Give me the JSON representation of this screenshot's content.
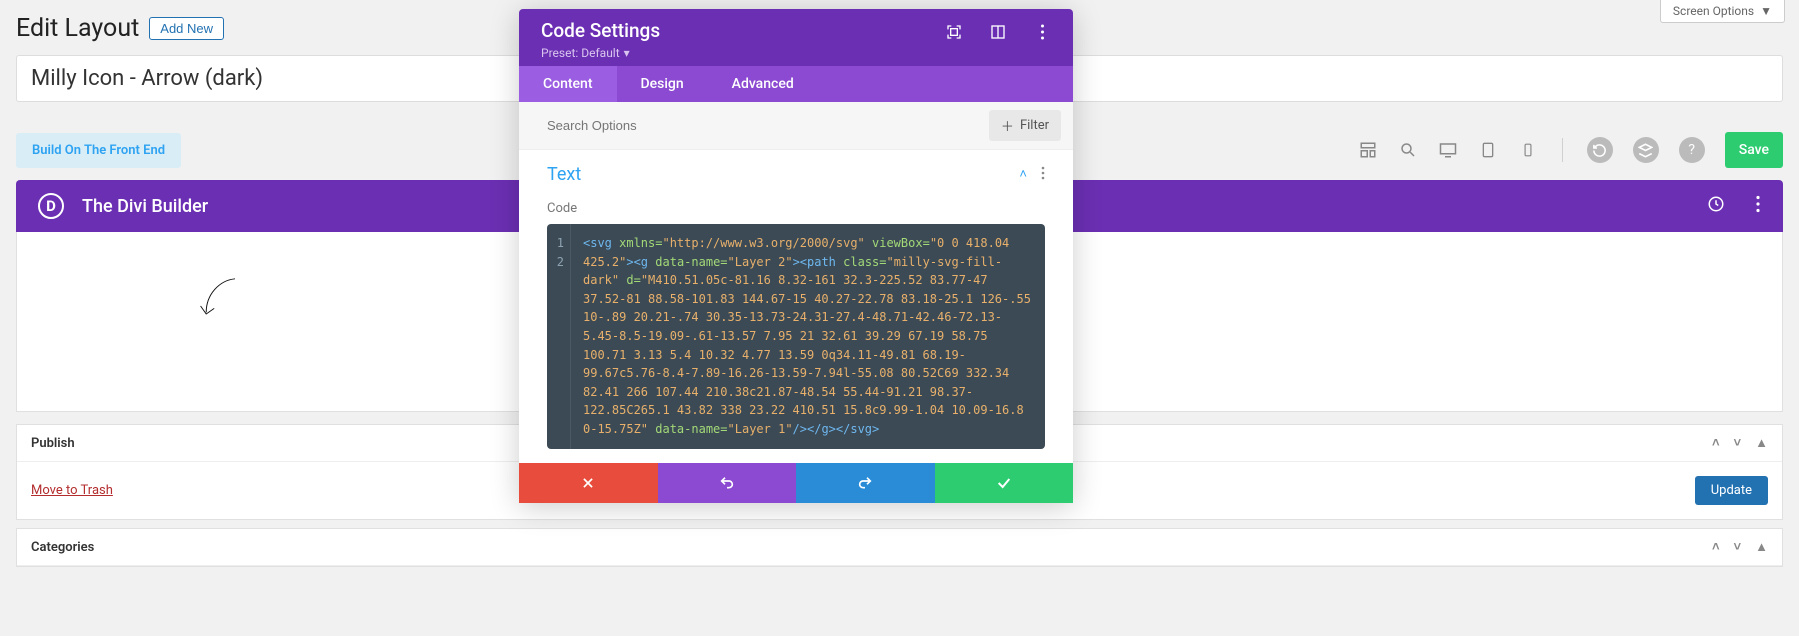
{
  "screen_options": "Screen Options",
  "header": {
    "page_title": "Edit Layout",
    "add_new": "Add New"
  },
  "title_field": "Milly Icon - Arrow (dark)",
  "frontend_btn": "Build On The Front End",
  "save_btn": "Save",
  "builder": {
    "logo": "D",
    "title": "The Divi Builder"
  },
  "publish_box": {
    "title": "Publish",
    "trash": "Move to Trash",
    "update": "Update"
  },
  "categories_box": {
    "title": "Categories"
  },
  "modal": {
    "title": "Code Settings",
    "preset": "Preset: Default",
    "tabs": {
      "content": "Content",
      "design": "Design",
      "advanced": "Advanced"
    },
    "search_placeholder": "Search Options",
    "filter": "Filter",
    "section_title": "Text",
    "field_label": "Code",
    "gutter": {
      "l1": "1",
      "l2": "2"
    },
    "code": {
      "t1": "<svg",
      "a1": " xmlns=",
      "v1": "\"http://www.w3.org/2000/svg\"",
      "a2": " viewBox=",
      "v2": "\"0 0 418.04 425.2\"",
      "t2": "><g",
      "a3": " data-name=",
      "v3": "\"Layer 2\"",
      "t3": "><path",
      "a4": " class=",
      "v4": "\"milly-svg-fill-dark\"",
      "a5": " d=",
      "v5": "\"M410.51.05c-81.16 8.32-161 32.3-225.52 83.77-47 37.52-81 88.58-101.83 144.67-15 40.27-22.78 83.18-25.1 126-.55 10-.89 20.21-.74 30.35-13.73-24.31-27.4-48.71-42.46-72.13-5.45-8.5-19.09-.61-13.57 7.95 21 32.61 39.29 67.19 58.75 100.71 3.13 5.4 10.32 4.77 13.59 0q34.11-49.81 68.19-99.67c5.76-8.4-7.89-16.26-13.59-7.94l-55.08 80.52C69 332.34 82.41 266 107.44 210.38c21.87-48.54 55.44-91.21 98.37-122.85C265.1 43.82 338 23.22 410.51 15.8c9.99-1.04 10.09-16.8 0-15.75Z\"",
      "a6": " data-name=",
      "v6": "\"Layer 1\"",
      "t4": "/></g></svg>"
    }
  }
}
